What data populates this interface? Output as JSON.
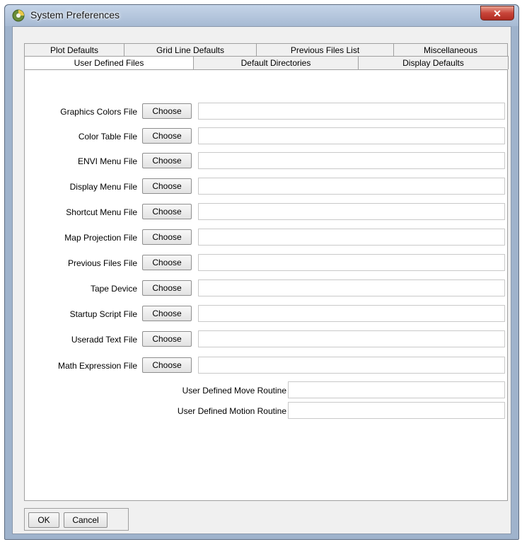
{
  "window": {
    "title": "System Preferences",
    "close_glyph": "✕"
  },
  "tabs": {
    "row1": [
      "Plot Defaults",
      "Grid Line Defaults",
      "Previous Files List",
      "Miscellaneous"
    ],
    "row2": [
      "User Defined Files",
      "Default Directories",
      "Display Defaults"
    ],
    "active": "User Defined Files"
  },
  "choose_label": "Choose",
  "file_rows": [
    {
      "label": "Graphics Colors File",
      "value": ""
    },
    {
      "label": "Color Table File",
      "value": ""
    },
    {
      "label": "ENVI Menu File",
      "value": ""
    },
    {
      "label": "Display Menu File",
      "value": ""
    },
    {
      "label": "Shortcut Menu File",
      "value": ""
    },
    {
      "label": "Map Projection File",
      "value": ""
    },
    {
      "label": "Previous Files File",
      "value": ""
    },
    {
      "label": "Tape Device",
      "value": ""
    },
    {
      "label": "Startup Script File",
      "value": ""
    },
    {
      "label": "Useradd Text File",
      "value": ""
    },
    {
      "label": "Math Expression File",
      "value": ""
    }
  ],
  "routines": [
    {
      "label": "User Defined Move Routine",
      "value": ""
    },
    {
      "label": "User Defined Motion Routine",
      "value": ""
    }
  ],
  "buttons": {
    "ok": "OK",
    "cancel": "Cancel"
  }
}
